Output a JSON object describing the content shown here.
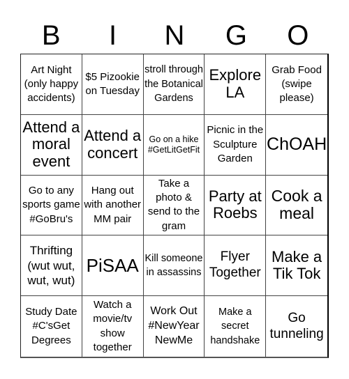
{
  "title_letters": [
    "B",
    "I",
    "N",
    "G",
    "O"
  ],
  "cells": [
    "Art Night (only happy accidents)",
    "$5 Pizookie on Tuesday",
    "stroll through the Botanical Gardens",
    "Explore LA",
    "Grab Food (swipe please)",
    "Attend a moral event",
    "Attend a concert",
    "Go on a hike #GetLitGetFit",
    "Picnic in the Sculpture Garden",
    "ChOAH",
    "Go to any sports game #GoBru's",
    "Hang out with another MM pair",
    "Take a photo & send to the gram",
    "Party at Roebs",
    "Cook a meal",
    "Thrifting (wut wut, wut, wut)",
    "PiSAA",
    "Kill someone in assassins",
    "Flyer Together",
    "Make a Tik Tok",
    "Study Date #C'sGet Degrees",
    "Watch a movie/tv show together",
    "Work Out #NewYear NewMe",
    "Make a secret handshake",
    "Go tunneling"
  ]
}
